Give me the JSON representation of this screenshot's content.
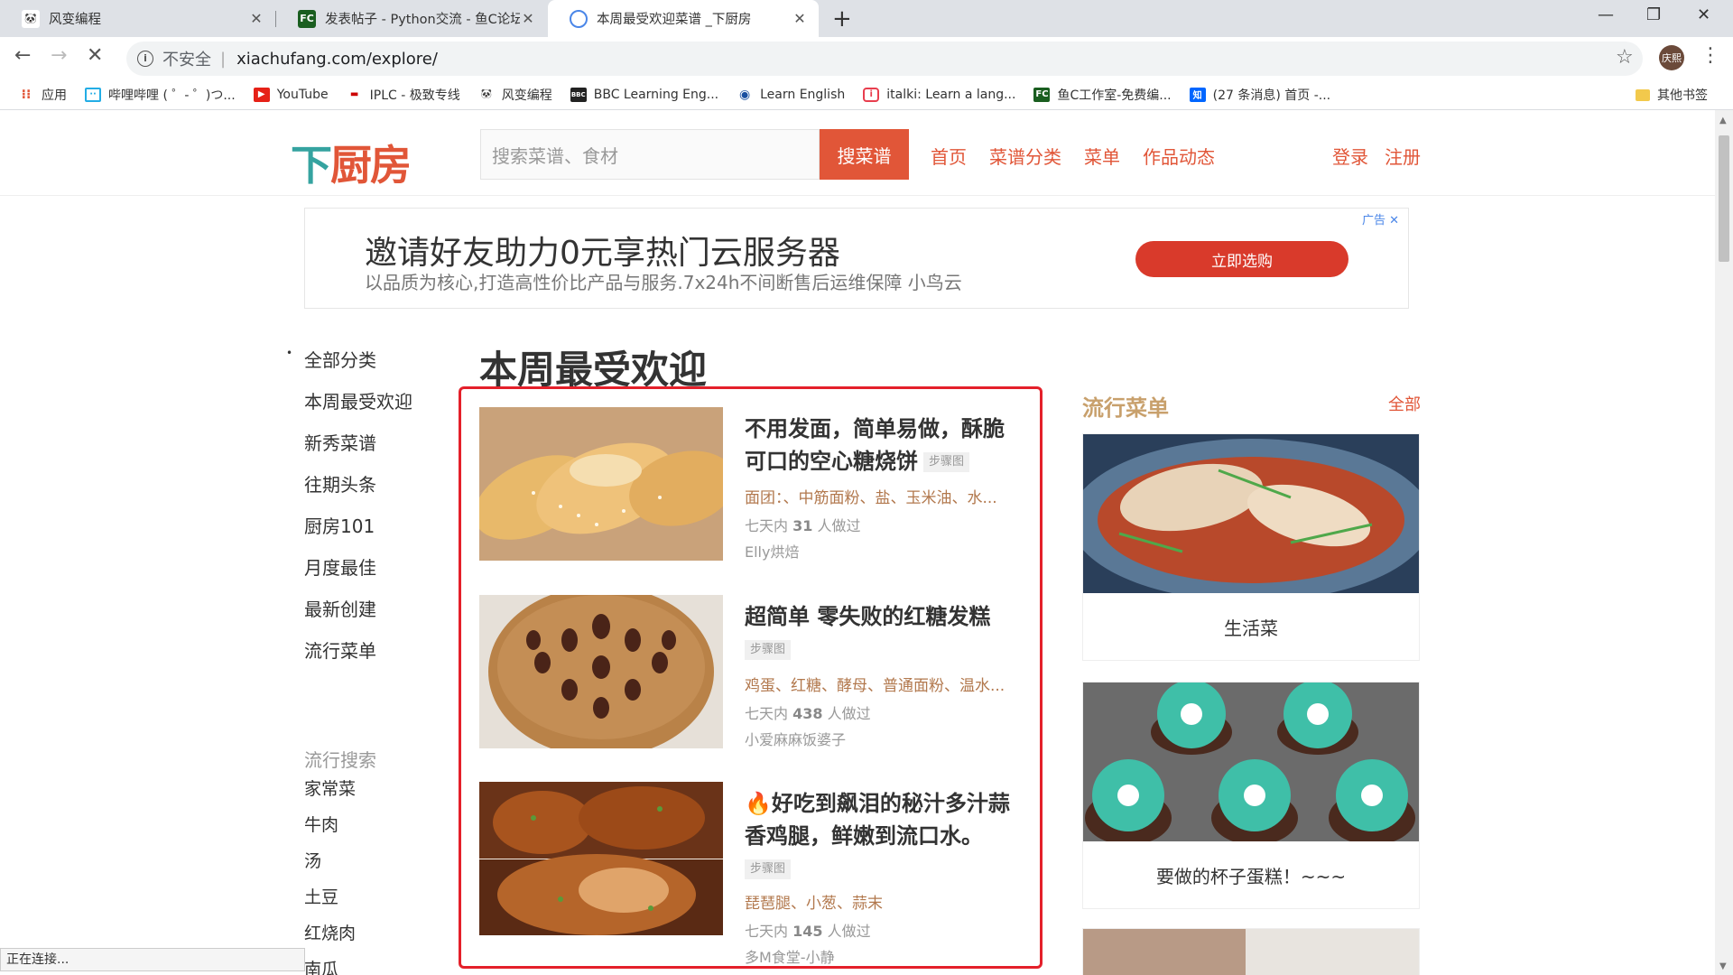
{
  "browser": {
    "tabs": [
      {
        "title": "风变编程",
        "favicon_icon": "panda-icon"
      },
      {
        "title": "发表帖子 - Python交流 - 鱼C论坛",
        "favicon_icon": "fc-icon"
      },
      {
        "title": "本周最受欢迎菜谱 _下厨房",
        "favicon_icon": "chrome-icon"
      }
    ],
    "address": {
      "security": "不安全",
      "url": "xiachufang.com/explore/"
    },
    "avatar_text": "庆熙",
    "bookmarks": [
      {
        "label": "应用",
        "icon": "apps-icon"
      },
      {
        "label": "哔哩哔哩 ( ゜- ゜)つ...",
        "icon": "bilibili-icon"
      },
      {
        "label": "YouTube",
        "icon": "youtube-icon"
      },
      {
        "label": "IPLC - 极致专线",
        "icon": "iplc-icon"
      },
      {
        "label": "风变编程",
        "icon": "panda-icon"
      },
      {
        "label": "BBC Learning Eng...",
        "icon": "bbc-icon"
      },
      {
        "label": "Learn English",
        "icon": "globe-icon"
      },
      {
        "label": "italki: Learn a lang...",
        "icon": "italki-icon"
      },
      {
        "label": "鱼C工作室-免费编...",
        "icon": "fc-icon"
      },
      {
        "label": "(27 条消息) 首页 -...",
        "icon": "zhihu-icon"
      }
    ],
    "other_bookmarks": "其他书签",
    "status_text": "正在连接..."
  },
  "site": {
    "logo": {
      "part1": "下",
      "part2": "厨房"
    },
    "search_placeholder": "搜索菜谱、食材",
    "search_button": "搜菜谱",
    "nav": [
      "首页",
      "菜谱分类",
      "菜单",
      "作品动态"
    ],
    "login": "登录",
    "register": "注册"
  },
  "ad": {
    "title": "邀请好友助力0元享热门云服务器",
    "subtitle": "以品质为核心,打造高性价比产品与服务.7x24h不间断售后运维保障 小鸟云",
    "button": "立即选购",
    "tag": "广告",
    "close": "✕"
  },
  "leftnav": {
    "items": [
      "全部分类",
      "本周最受欢迎",
      "新秀菜谱",
      "往期头条",
      "厨房101",
      "月度最佳",
      "最新创建",
      "流行菜单"
    ],
    "popular_title": "流行搜索",
    "popular": [
      "家常菜",
      "牛肉",
      "汤",
      "土豆",
      "红烧肉",
      "南瓜"
    ]
  },
  "main": {
    "title": "本周最受欢迎",
    "recipes": [
      {
        "title": "不用发面，简单易做，酥脆可口的空心糖烧饼",
        "step_tag": "步骤图",
        "ingredients": "面团：、中筋面粉、盐、玉米油、水...",
        "stats_prefix": "七天内",
        "count": "31",
        "stats_suffix": "人做过",
        "author": "Elly烘焙"
      },
      {
        "title": "超简单 零失败的红糖发糕",
        "step_tag": "步骤图",
        "ingredients": "鸡蛋、红糖、酵母、普通面粉、温水...",
        "stats_prefix": "七天内",
        "count": "438",
        "stats_suffix": "人做过",
        "author": "小爱麻麻饭婆子"
      },
      {
        "title": "🔥好吃到飙泪的秘汁多汁蒜香鸡腿，鲜嫩到流口水。",
        "step_tag": "步骤图",
        "ingredients": "琵琶腿、小葱、蒜末",
        "stats_prefix": "七天内",
        "count": "145",
        "stats_suffix": "人做过",
        "author": "多M食堂-小静"
      }
    ]
  },
  "sidebar": {
    "title": "流行菜单",
    "all": "全部",
    "menus": [
      {
        "label": "生活菜"
      },
      {
        "label": "要做的杯子蛋糕！~~~"
      }
    ]
  },
  "colors": {
    "brand_red": "#e15638",
    "brand_teal": "#35a3a0",
    "highlight_box": "#e4202a"
  }
}
